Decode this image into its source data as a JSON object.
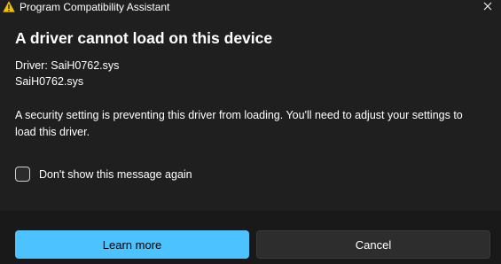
{
  "window": {
    "title": "Program Compatibility Assistant",
    "title_icon": "warning-icon",
    "close_icon": "close-icon"
  },
  "content": {
    "heading": "A driver cannot load on this device",
    "driver_label": "Driver: SaiH0762.sys",
    "driver_file": "SaiH0762.sys",
    "message": "A security setting is preventing this driver from loading. You'll need to adjust your settings to load this driver.",
    "checkbox_label": "Don't show this message again",
    "checkbox_checked": false
  },
  "buttons": {
    "primary_label": "Learn more",
    "secondary_label": "Cancel"
  },
  "colors": {
    "accent": "#4cc2ff",
    "warning": "#f2c200",
    "background": "#1f1f1f",
    "footer": "#191919"
  }
}
